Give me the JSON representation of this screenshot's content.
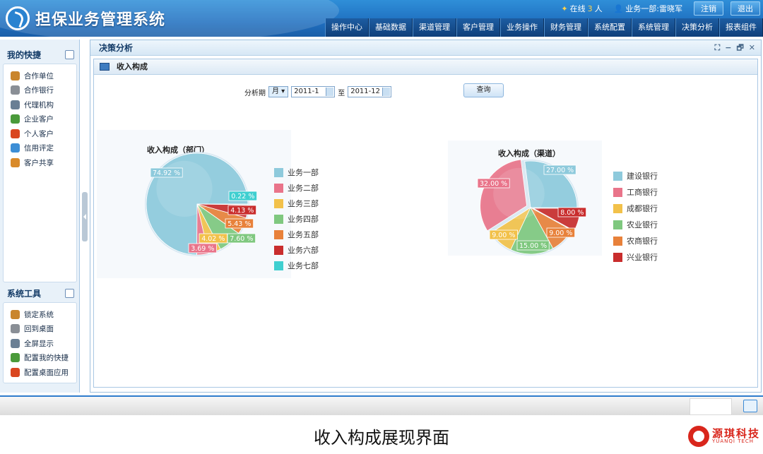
{
  "app": {
    "title": "担保业务管理系统"
  },
  "topbar": {
    "online_prefix": "在线",
    "online_count": "3",
    "online_suffix": "人",
    "user": "业务一部:雷晓军",
    "logout_label": "注销",
    "exit_label": "退出"
  },
  "nav": [
    "操作中心",
    "基础数据",
    "渠道管理",
    "客户管理",
    "业务操作",
    "财务管理",
    "系统配置",
    "系统管理",
    "决策分析",
    "报表组件"
  ],
  "sidebar": {
    "shortcuts_title": "我的快捷",
    "shortcuts": [
      "合作单位",
      "合作银行",
      "代理机构",
      "企业客户",
      "个人客户",
      "信用评定",
      "客户共享"
    ],
    "tools_title": "系统工具",
    "tools": [
      "锁定系统",
      "回到桌面",
      "全屏显示",
      "配置我的快捷",
      "配置桌面应用"
    ]
  },
  "window": {
    "title": "决策分析",
    "controls": [
      "⛶",
      "−",
      "🗗",
      "✕"
    ]
  },
  "panel": {
    "title": "收入构成"
  },
  "form": {
    "period_label": "分析期",
    "period_unit": "月",
    "from": "2011-1",
    "to_label": "至",
    "to": "2011-12",
    "query_label": "查询"
  },
  "colors": {
    "s1": "#8ecadc",
    "s2": "#e9748a",
    "s3": "#f2c14a",
    "s4": "#7fc87f",
    "s5": "#e8813a",
    "s6": "#c92d2d",
    "s7": "#3fcfd0"
  },
  "chart_data": [
    {
      "type": "pie",
      "title": "收入构成（部门）",
      "labels": [
        "业务一部",
        "业务二部",
        "业务三部",
        "业务四部",
        "业务五部",
        "业务六部",
        "业务七部"
      ],
      "values": [
        74.92,
        3.69,
        4.02,
        7.6,
        5.43,
        4.13,
        0.22
      ],
      "value_labels": [
        "74.92 %",
        "3.69 %",
        "4.02 %",
        "7.60 %",
        "5.43 %",
        "4.13 %",
        "0.22 %"
      ],
      "legend": "right"
    },
    {
      "type": "pie",
      "title": "收入构成（渠道）",
      "labels": [
        "建设银行",
        "工商银行",
        "成都银行",
        "农业银行",
        "农商银行",
        "兴业银行"
      ],
      "values": [
        27.0,
        32.0,
        9.0,
        15.0,
        9.0,
        8.0
      ],
      "value_labels": [
        "27.00 %",
        "32.00 %",
        "9.00 %",
        "15.00 %",
        "9.00 %",
        "8.00 %"
      ],
      "legend": "right"
    }
  ],
  "caption": "收入构成展现界面",
  "brand": {
    "name": "源琪科技",
    "en": "YUANQI TECH"
  }
}
